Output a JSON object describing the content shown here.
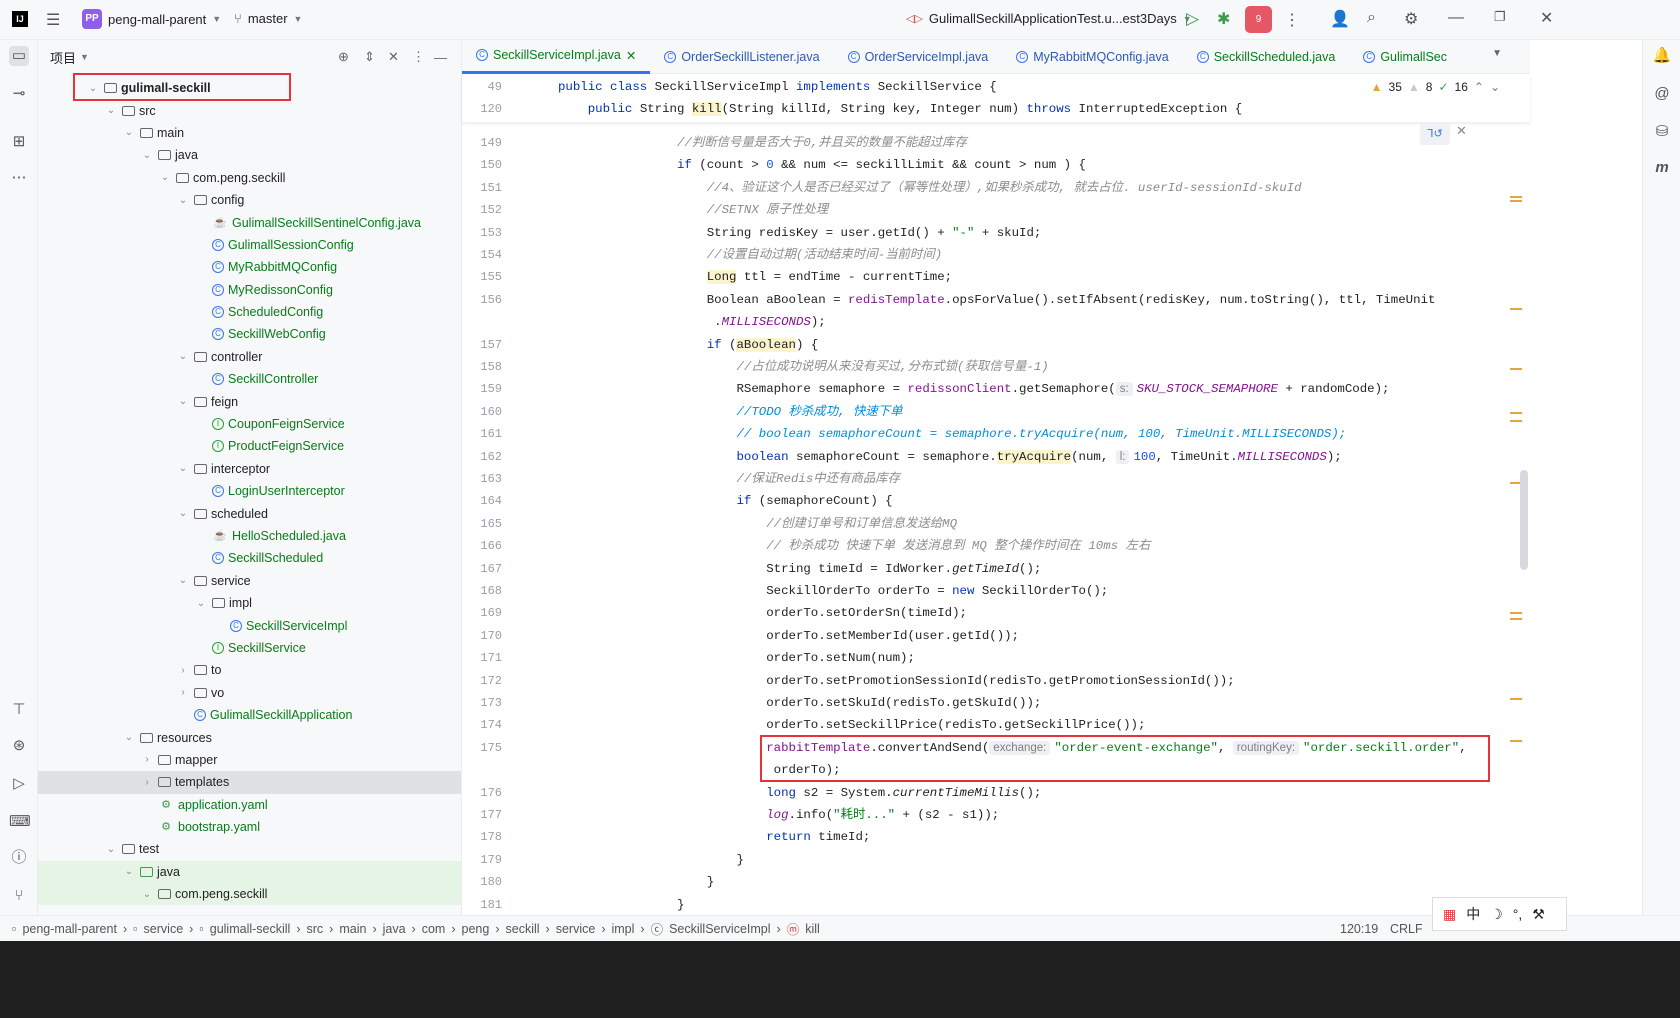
{
  "topbar": {
    "project_badge": "PP",
    "project": "peng-mall-parent",
    "branch": "master",
    "run_config": "GulimallSeckillApplicationTest.u...est3Days",
    "notif_count": "9"
  },
  "project_panel": {
    "title": "项目"
  },
  "tree": [
    {
      "l": 1,
      "c": "v",
      "i": "module",
      "t": "gulimall-seckill",
      "bold": true
    },
    {
      "l": 2,
      "c": "v",
      "i": "folder",
      "t": "src"
    },
    {
      "l": 3,
      "c": "v",
      "i": "folder",
      "t": "main"
    },
    {
      "l": 4,
      "c": "v",
      "i": "folder",
      "t": "java"
    },
    {
      "l": 5,
      "c": "v",
      "i": "pkg",
      "t": "com.peng.seckill"
    },
    {
      "l": 6,
      "c": "v",
      "i": "pkg",
      "t": "config"
    },
    {
      "l": 7,
      "c": "",
      "i": "java",
      "t": "GulimallSeckillSentinelConfig.java",
      "g": true
    },
    {
      "l": 7,
      "c": "",
      "i": "class",
      "t": "GulimallSessionConfig",
      "g": true
    },
    {
      "l": 7,
      "c": "",
      "i": "class",
      "t": "MyRabbitMQConfig",
      "g": true
    },
    {
      "l": 7,
      "c": "",
      "i": "class",
      "t": "MyRedissonConfig",
      "g": true
    },
    {
      "l": 7,
      "c": "",
      "i": "class",
      "t": "ScheduledConfig",
      "g": true
    },
    {
      "l": 7,
      "c": "",
      "i": "class",
      "t": "SeckillWebConfig",
      "g": true
    },
    {
      "l": 6,
      "c": "v",
      "i": "pkg",
      "t": "controller"
    },
    {
      "l": 7,
      "c": "",
      "i": "class",
      "t": "SeckillController",
      "g": true
    },
    {
      "l": 6,
      "c": "v",
      "i": "pkg",
      "t": "feign"
    },
    {
      "l": 7,
      "c": "",
      "i": "intf",
      "t": "CouponFeignService",
      "g": true
    },
    {
      "l": 7,
      "c": "",
      "i": "intf",
      "t": "ProductFeignService",
      "g": true
    },
    {
      "l": 6,
      "c": "v",
      "i": "pkg",
      "t": "interceptor"
    },
    {
      "l": 7,
      "c": "",
      "i": "class",
      "t": "LoginUserInterceptor",
      "g": true
    },
    {
      "l": 6,
      "c": "v",
      "i": "pkg",
      "t": "scheduled"
    },
    {
      "l": 7,
      "c": "",
      "i": "java",
      "t": "HelloScheduled.java",
      "g": true
    },
    {
      "l": 7,
      "c": "",
      "i": "class",
      "t": "SeckillScheduled",
      "g": true
    },
    {
      "l": 6,
      "c": "v",
      "i": "pkg",
      "t": "service"
    },
    {
      "l": 7,
      "c": "v",
      "i": "pkg",
      "t": "impl"
    },
    {
      "l": 8,
      "c": "",
      "i": "class",
      "t": "SeckillServiceImpl",
      "g": true
    },
    {
      "l": 7,
      "c": "",
      "i": "intf",
      "t": "SeckillService",
      "g": true
    },
    {
      "l": 6,
      "c": ">",
      "i": "pkg",
      "t": "to"
    },
    {
      "l": 6,
      "c": ">",
      "i": "pkg",
      "t": "vo"
    },
    {
      "l": 6,
      "c": "",
      "i": "class",
      "t": "GulimallSeckillApplication",
      "g": true
    },
    {
      "l": 3,
      "c": "v",
      "i": "folder",
      "t": "resources"
    },
    {
      "l": 4,
      "c": ">",
      "i": "folder",
      "t": "mapper"
    },
    {
      "l": 4,
      "c": ">",
      "i": "folder",
      "t": "templates",
      "sel": true
    },
    {
      "l": 4,
      "c": "",
      "i": "yaml",
      "t": "application.yaml",
      "g": true
    },
    {
      "l": 4,
      "c": "",
      "i": "yaml",
      "t": "bootstrap.yaml",
      "g": true
    },
    {
      "l": 2,
      "c": "v",
      "i": "folder",
      "t": "test"
    },
    {
      "l": 3,
      "c": "v",
      "i": "folder",
      "t": "java",
      "test": true
    },
    {
      "l": 4,
      "c": "v",
      "i": "pkg",
      "t": "com.peng.seckill",
      "test": true
    }
  ],
  "tabs": [
    "SeckillServiceImpl.java",
    "OrderSeckillListener.java",
    "OrderServiceImpl.java",
    "MyRabbitMQConfig.java",
    "SeckillScheduled.java",
    "GulimallSec"
  ],
  "inspections": {
    "warnings": "35",
    "weak_warnings": "8",
    "ok": "16"
  },
  "sticky": [
    {
      "n": "49",
      "t": [
        [
          "kw",
          "public class "
        ],
        [
          "",
          "SeckillServiceImpl "
        ],
        [
          "kw",
          "implements "
        ],
        [
          "",
          "SeckillService {"
        ]
      ]
    },
    {
      "n": "120",
      "t": [
        [
          "",
          "    "
        ],
        [
          "kw",
          "public "
        ],
        [
          "",
          "String "
        ],
        [
          "hl",
          "kill"
        ],
        [
          "",
          "(String killId, String key, Integer num) "
        ],
        [
          "kw",
          "throws "
        ],
        [
          "",
          "InterruptedException {"
        ]
      ]
    }
  ],
  "code": [
    {
      "n": "149",
      "t": [
        [
          "",
          "                "
        ],
        [
          "cmt",
          "//判断信号量是否大于0,并且买的数量不能超过库存"
        ]
      ]
    },
    {
      "n": "150",
      "t": [
        [
          "",
          "                "
        ],
        [
          "kw",
          "if"
        ],
        [
          "",
          " (count > "
        ],
        [
          "num",
          "0"
        ],
        [
          "",
          " && num <= seckillLimit && count > num ) {"
        ]
      ]
    },
    {
      "n": "151",
      "t": [
        [
          "",
          "                    "
        ],
        [
          "cmt",
          "//4、验证这个人是否已经买过了（幂等性处理）,如果秒杀成功, 就去占位. userId-sessionId-skuId"
        ]
      ]
    },
    {
      "n": "152",
      "t": [
        [
          "",
          "                    "
        ],
        [
          "cmt",
          "//SETNX 原子性处理"
        ]
      ]
    },
    {
      "n": "153",
      "t": [
        [
          "",
          "                    String redisKey = user.getId() + "
        ],
        [
          "str",
          "\"-\""
        ],
        [
          "",
          " + skuId;"
        ]
      ]
    },
    {
      "n": "154",
      "t": [
        [
          "",
          "                    "
        ],
        [
          "cmt",
          "//设置自动过期(活动结束时间-当前时间)"
        ]
      ]
    },
    {
      "n": "155",
      "t": [
        [
          "",
          "                    "
        ],
        [
          "hl",
          "Long"
        ],
        [
          "",
          " ttl = endTime - currentTime;"
        ]
      ]
    },
    {
      "n": "156",
      "t": [
        [
          "",
          "                    Boolean aBoolean = "
        ],
        [
          "fld",
          "redisTemplate"
        ],
        [
          "",
          ".opsForValue().setIfAbsent(redisKey, num.toString(), ttl, TimeUnit"
        ]
      ]
    },
    {
      "n": "",
      "t": [
        [
          "",
          "                     ."
        ],
        [
          "sfld",
          "MILLISECONDS"
        ],
        [
          "",
          ");"
        ]
      ]
    },
    {
      "n": "157",
      "t": [
        [
          "",
          "                    "
        ],
        [
          "kw",
          "if"
        ],
        [
          "",
          " ("
        ],
        [
          "hl",
          "aBoolean"
        ],
        [
          "",
          ") {"
        ]
      ]
    },
    {
      "n": "158",
      "t": [
        [
          "",
          "                        "
        ],
        [
          "cmt",
          "//占位成功说明从来没有买过,分布式锁(获取信号量-1)"
        ]
      ]
    },
    {
      "n": "159",
      "t": [
        [
          "",
          "                        RSemaphore semaphore = "
        ],
        [
          "fld",
          "redissonClient"
        ],
        [
          "",
          ".getSemaphore("
        ],
        [
          "hint",
          "s:"
        ],
        [
          "sfld",
          "SKU_STOCK_SEMAPHORE"
        ],
        [
          "",
          " + randomCode);"
        ]
      ]
    },
    {
      "n": "160",
      "t": [
        [
          "",
          "                        "
        ],
        [
          "todo",
          "//TODO 秒杀成功, 快速下单"
        ]
      ]
    },
    {
      "n": "161",
      "t": [
        [
          "",
          "                        "
        ],
        [
          "todo",
          "// boolean semaphoreCount = semaphore.tryAcquire(num, 100, TimeUnit.MILLISECONDS);"
        ]
      ]
    },
    {
      "n": "162",
      "t": [
        [
          "",
          "                        "
        ],
        [
          "kw",
          "boolean"
        ],
        [
          "",
          " semaphoreCount = semaphore."
        ],
        [
          "hl",
          "tryAcquire"
        ],
        [
          "",
          "(num, "
        ],
        [
          "hint",
          "l:"
        ],
        [
          "num",
          "100"
        ],
        [
          "",
          ", TimeUnit."
        ],
        [
          "sfld",
          "MILLISECONDS"
        ],
        [
          "",
          ");"
        ]
      ]
    },
    {
      "n": "163",
      "t": [
        [
          "",
          "                        "
        ],
        [
          "cmt",
          "//保证Redis中还有商品库存"
        ]
      ]
    },
    {
      "n": "164",
      "t": [
        [
          "",
          "                        "
        ],
        [
          "kw",
          "if"
        ],
        [
          "",
          " (semaphoreCount) {"
        ]
      ]
    },
    {
      "n": "165",
      "t": [
        [
          "",
          "                            "
        ],
        [
          "cmt",
          "//创建订单号和订单信息发送给MQ"
        ]
      ]
    },
    {
      "n": "166",
      "t": [
        [
          "",
          "                            "
        ],
        [
          "cmt",
          "// 秒杀成功 快速下单 发送消息到 MQ 整个操作时间在 10ms 左右"
        ]
      ]
    },
    {
      "n": "167",
      "t": [
        [
          "",
          "                            String timeId = IdWorker."
        ],
        [
          "it",
          "getTimeId"
        ],
        [
          "",
          "();"
        ]
      ]
    },
    {
      "n": "168",
      "t": [
        [
          "",
          "                            SeckillOrderTo orderTo = "
        ],
        [
          "kw",
          "new"
        ],
        [
          "",
          " SeckillOrderTo();"
        ]
      ]
    },
    {
      "n": "169",
      "t": [
        [
          "",
          "                            orderTo.setOrderSn(timeId);"
        ]
      ]
    },
    {
      "n": "170",
      "t": [
        [
          "",
          "                            orderTo.setMemberId(user.getId());"
        ]
      ]
    },
    {
      "n": "171",
      "t": [
        [
          "",
          "                            orderTo.setNum(num);"
        ]
      ]
    },
    {
      "n": "172",
      "t": [
        [
          "",
          "                            orderTo.setPromotionSessionId(redisTo.getPromotionSessionId());"
        ]
      ]
    },
    {
      "n": "173",
      "t": [
        [
          "",
          "                            orderTo.setSkuId(redisTo.getSkuId());"
        ]
      ]
    },
    {
      "n": "174",
      "t": [
        [
          "",
          "                            orderTo.setSeckillPrice(redisTo.getSeckillPrice());"
        ]
      ]
    },
    {
      "n": "175",
      "t": [
        [
          "",
          "                            "
        ],
        [
          "fld",
          "rabbitTemplate"
        ],
        [
          "",
          ".convertAndSend("
        ],
        [
          "hint",
          "exchange:"
        ],
        [
          "str",
          "\"order-event-exchange\""
        ],
        [
          "",
          ", "
        ],
        [
          "hint",
          "routingKey:"
        ],
        [
          "str",
          "\"order.seckill.order\""
        ],
        [
          "",
          ","
        ]
      ]
    },
    {
      "n": "",
      "t": [
        [
          "",
          "                             orderTo);"
        ]
      ]
    },
    {
      "n": "176",
      "t": [
        [
          "",
          "                            "
        ],
        [
          "kw",
          "long"
        ],
        [
          "",
          " s2 = System."
        ],
        [
          "it",
          "currentTimeMillis"
        ],
        [
          "",
          "();"
        ]
      ]
    },
    {
      "n": "177",
      "t": [
        [
          "",
          "                            "
        ],
        [
          "sfld",
          "log"
        ],
        [
          "",
          ".info("
        ],
        [
          "str",
          "\"耗时...\""
        ],
        [
          "",
          " + (s2 - s1));"
        ]
      ]
    },
    {
      "n": "178",
      "t": [
        [
          "",
          "                            "
        ],
        [
          "kw",
          "return"
        ],
        [
          "",
          " timeId;"
        ]
      ]
    },
    {
      "n": "179",
      "t": [
        [
          "",
          "                        }"
        ]
      ]
    },
    {
      "n": "180",
      "t": [
        [
          "",
          "                    }"
        ]
      ]
    },
    {
      "n": "181",
      "t": [
        [
          "",
          "                }"
        ]
      ]
    }
  ],
  "statusbar": {
    "crumbs": [
      "peng-mall-parent",
      "service",
      "gulimall-seckill",
      "src",
      "main",
      "java",
      "com",
      "peng",
      "seckill",
      "service",
      "impl",
      "SeckillServiceImpl",
      "kill"
    ],
    "position": "120:19",
    "line_sep": "CRLF"
  },
  "ime": {
    "lang": "中"
  }
}
